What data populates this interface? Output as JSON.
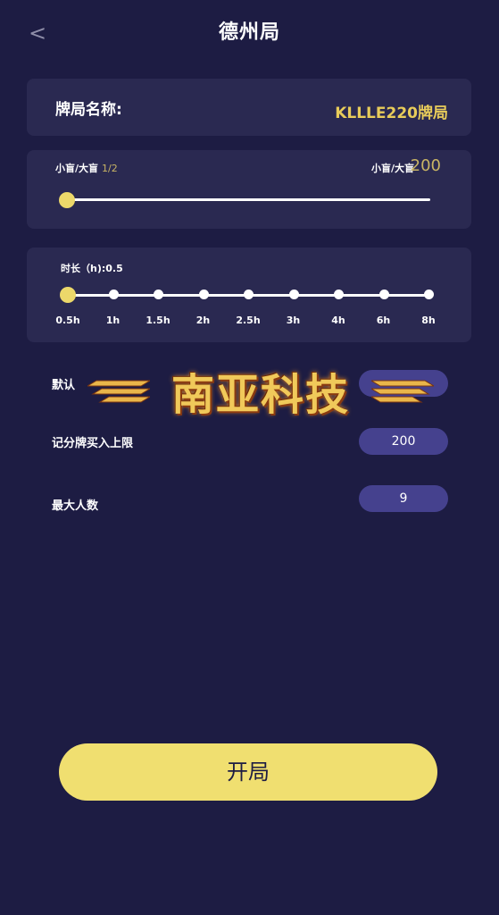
{
  "header": {
    "back_label": "<",
    "title": "德州局"
  },
  "game_name": {
    "label": "牌局名称:",
    "value": "KLLLE220牌局"
  },
  "blinds": {
    "label": "小盲/大盲",
    "value": "1/2",
    "max_label": "小盲/大盲",
    "max_value": "200",
    "slider_fraction": 0.0
  },
  "duration": {
    "label": "时长（h):0.5",
    "ticks": [
      "0.5h",
      "1h",
      "1.5h",
      "2h",
      "2.5h",
      "3h",
      "4h",
      "6h",
      "8h"
    ],
    "selected_index": 0
  },
  "settings": {
    "default_row": {
      "label": "默认",
      "value": ""
    },
    "buyin_limit": {
      "label": "记分牌买入上限",
      "value": "200"
    },
    "max_players": {
      "label": "最大人数",
      "value": "9"
    }
  },
  "watermark": {
    "text": "南亚科技"
  },
  "start_button": {
    "label": "开局"
  },
  "colors": {
    "background": "#1d1c43",
    "card": "#2a2951",
    "accent_yellow": "#f0df70",
    "gold_text": "#e8cc5a",
    "pill": "#45418e"
  }
}
